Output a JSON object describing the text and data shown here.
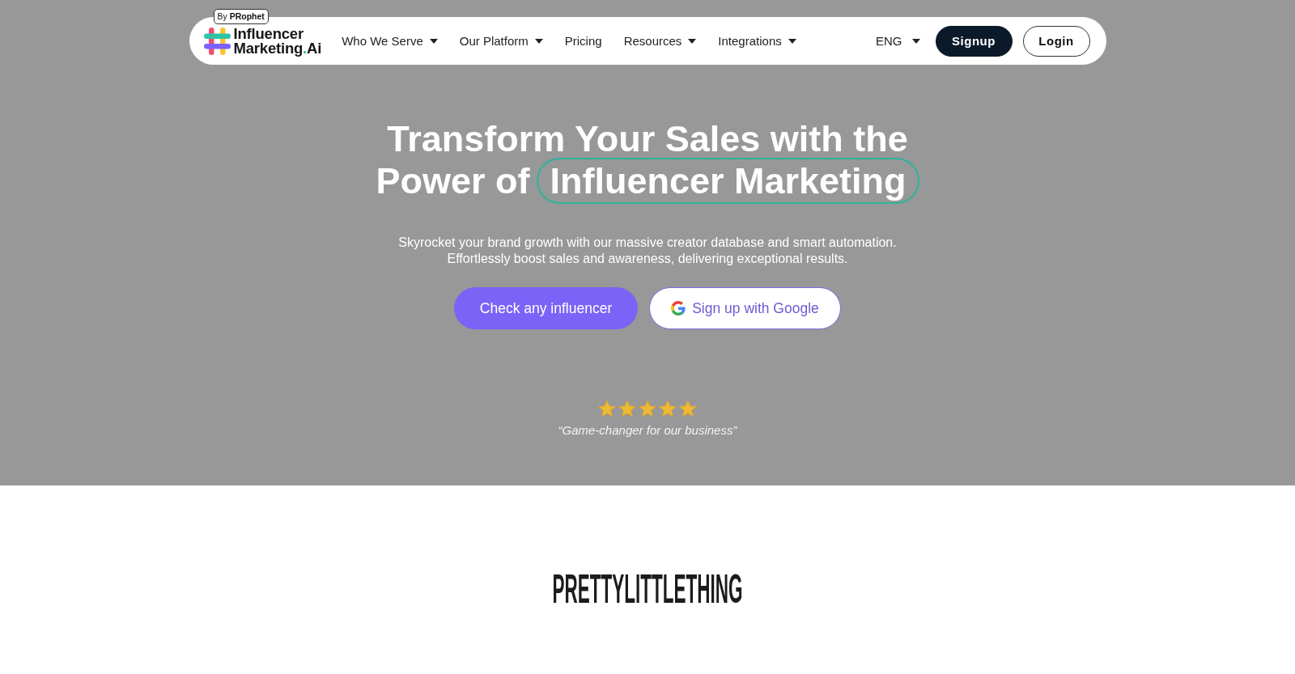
{
  "nav": {
    "logo": {
      "badge": "By **PRophet**",
      "wordmark_line_1": "Influencer",
      "wordmark_line_2": "Marketing",
      "wordmark_dot": ".",
      "wordmark_suffix": "Ai"
    },
    "menu": [
      {
        "label": "Who We Serve",
        "dropdown": true
      },
      {
        "label": "Our Platform",
        "dropdown": true
      },
      {
        "label": "Pricing",
        "dropdown": false
      },
      {
        "label": "Resources",
        "dropdown": true
      },
      {
        "label": "Integrations",
        "dropdown": true
      }
    ],
    "language": {
      "label": "ENG",
      "dropdown": true
    },
    "buttons": [
      {
        "label": "Signup",
        "kind": "primary"
      },
      {
        "label": "Login",
        "kind": "outline"
      }
    ]
  },
  "hero": {
    "title_line_1": "Transform Your Sales with the",
    "title_line_2": "Power of",
    "title_highlight": "Influencer Marketing",
    "subtitle_lines": [
      "Skyrocket your brand growth with our massive creator database and smart automation.",
      "Effortlessly boost sales and awareness, delivering exceptional results."
    ],
    "buttons": [
      {
        "label": "Check any influencer",
        "kind": "primary"
      },
      {
        "label": "Sign up with Google",
        "kind": "google"
      }
    ],
    "review": {
      "stars": 5,
      "quote": "“Game-changer for our business”"
    }
  },
  "brands": {
    "logo": "PRETTYLITTLETHING"
  }
}
